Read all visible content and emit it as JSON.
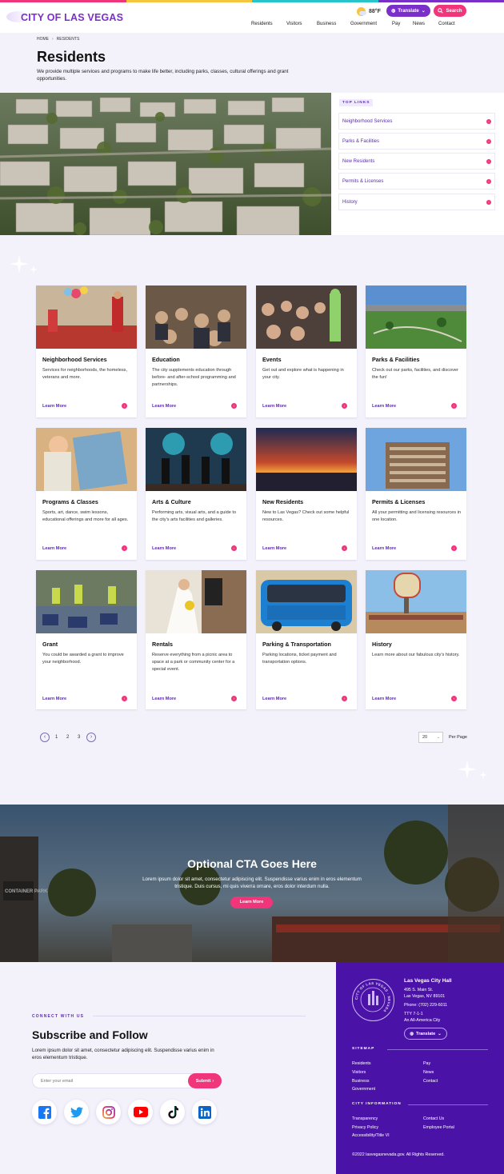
{
  "colors": {
    "stripe": [
      "#f0357a",
      "#f5c542",
      "#27c4c9",
      "#7a30c8"
    ],
    "brand_purple": "#7a30c8",
    "accent_pink": "#f0357a",
    "footer_bg": "#4b12a8"
  },
  "header": {
    "logo": "CITY OF LAS VEGAS",
    "weather": "88°F",
    "weather_icon": "sun-cloud-icon",
    "translate": "Translate",
    "search": "Search",
    "nav": [
      "Residents",
      "Visitors",
      "Business",
      "Government",
      "Pay",
      "News",
      "Contact"
    ]
  },
  "breadcrumb": {
    "home": "HOME",
    "sep": "›",
    "current": "RESIDENTS"
  },
  "page": {
    "title": "Residents",
    "intro": "We provide multiple services and programs to make life better, including parks, classes, cultural offerings and grant opportunities."
  },
  "top_links": {
    "label": "TOP LINKS",
    "items": [
      "Neighborhood Services",
      "Parks & Facilities",
      "New Residents",
      "Permits & Licenses",
      "History"
    ]
  },
  "cards": [
    {
      "title": "Neighborhood Services",
      "desc": "Services for neighborhoods, the homeless, veterans and more.",
      "link": "Learn More"
    },
    {
      "title": "Education",
      "desc": "The city supplements education through before- and after-school programming and partnerships.",
      "link": "Learn More"
    },
    {
      "title": "Events",
      "desc": "Get out and explore what is happening in your city.",
      "link": "Learn More"
    },
    {
      "title": "Parks & Facilities",
      "desc": "Check out our parks, facilities, and discover the fun!",
      "link": "Learn More"
    },
    {
      "title": "Programs & Classes",
      "desc": "Sports, art, dance, swim lessons, educational offerings and more for all ages.",
      "link": "Learn More"
    },
    {
      "title": "Arts & Culture",
      "desc": "Performing arts, visual arts, and a guide to the city's arts facilities and galleries.",
      "link": "Learn More"
    },
    {
      "title": "New Residents",
      "desc": "New to Las Vegas? Check out some helpful resources.",
      "link": "Learn More"
    },
    {
      "title": "Permits & Licenses",
      "desc": "All your permitting and licensing resources in one location.",
      "link": "Learn More"
    },
    {
      "title": "Grant",
      "desc": "You could be awarded a grant to improve your neighborhood.",
      "link": "Learn More"
    },
    {
      "title": "Rentals",
      "desc": "Reserve everything from a picnic area to space at a park or community center for a special event.",
      "link": "Learn More"
    },
    {
      "title": "Parking & Transportation",
      "desc": "Parking locations, ticket payment and transportation options.",
      "link": "Learn More"
    },
    {
      "title": "History",
      "desc": "Learn more about our fabulous city's history.",
      "link": "Learn More"
    }
  ],
  "pagination": {
    "prev": "‹",
    "next": "›",
    "pages": [
      "1",
      "2",
      "3"
    ],
    "per_page_value": "20",
    "per_page_label": "Per Page"
  },
  "cta": {
    "title": "Optional CTA Goes Here",
    "body": "Lorem ipsum dolor sit amet, consectetur adipiscing elit. Suspendisse varius enim in eros elementum tristique. Duis cursus, mi quis viverra ornare, eros dolor interdum nulla.",
    "button": "Learn More",
    "sign_text": "CONTAINER PARK"
  },
  "subscribe": {
    "eyebrow": "CONNECT WITH US",
    "title": "Subscribe and Follow",
    "body": "Lorem ipsum dolor sit amet, consectetur adipiscing elit. Suspendisse varius enim in eros elementum tristique.",
    "email_placeholder": "Enter your email",
    "submit": "Submit",
    "social": [
      "facebook-icon",
      "twitter-icon",
      "instagram-icon",
      "youtube-icon",
      "tiktok-icon",
      "linkedin-icon"
    ]
  },
  "footer": {
    "city_hall": {
      "title": "Las Vegas City Hall",
      "lines": [
        "495 S. Main St.",
        "Las Vegas, NV 89101",
        "Phone: (702) 229-6011",
        "TTY 7-1-1",
        "An All-America City"
      ],
      "translate": "Translate"
    },
    "seal_text": "CITY OF LAS VEGAS · NEVADA",
    "sitemap_label": "SITEMAP",
    "sitemap": [
      [
        "Residents",
        "Visitors",
        "Business",
        "Government"
      ],
      [
        "Pay",
        "News",
        "Contact"
      ]
    ],
    "city_info_label": "CITY INFORMATION",
    "city_info": [
      [
        "Transparency",
        "Privacy Policy",
        "Accessibility/Title VI"
      ],
      [
        "Contact Us",
        "Employee Portal"
      ]
    ],
    "copyright": "©2022 lasvegasnevada.gov. All Rights Reserved."
  }
}
